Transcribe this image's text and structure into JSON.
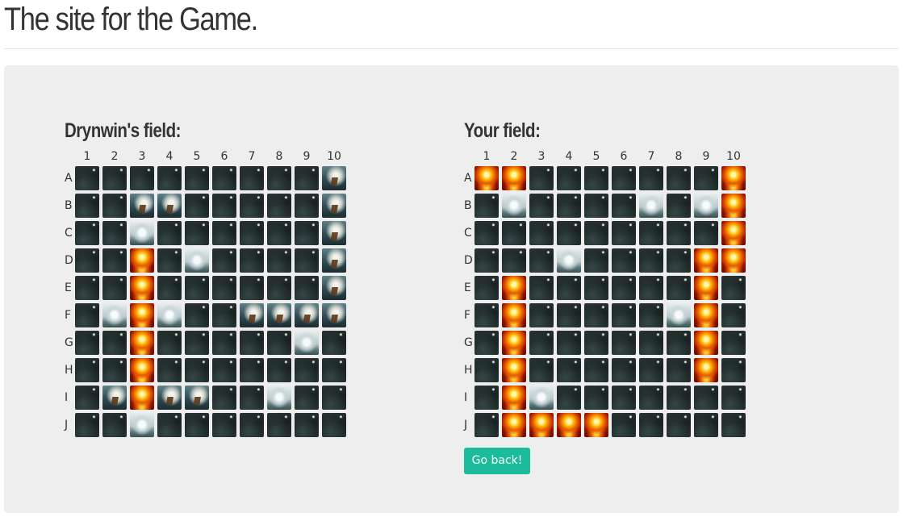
{
  "page": {
    "title": "The site for the Game."
  },
  "colors": {
    "accent": "#1abc9c",
    "panel": "#eeeeee"
  },
  "columns": [
    "1",
    "2",
    "3",
    "4",
    "5",
    "6",
    "7",
    "8",
    "9",
    "10"
  ],
  "rows": [
    "A",
    "B",
    "C",
    "D",
    "E",
    "F",
    "G",
    "H",
    "I",
    "J"
  ],
  "cell_legend": {
    "W": "water-tile",
    "M": "miss-splash-tile",
    "H": "hit-explosion-tile",
    "S": "ship-tile"
  },
  "opponent": {
    "title": "Drynwin's field:",
    "grid": [
      "WWWWWWWWWS",
      "WWSSWWWWWS",
      "WWMWWWWWWS",
      "WWHWMWWWWS",
      "WWHWWWWWWS",
      "WMHMWWSSSS",
      "WWHWWWWWMW",
      "WWHWWWWWWW",
      "WSHSSWWMWW",
      "WWMWWWWWWW"
    ]
  },
  "player": {
    "title": "Your field:",
    "grid": [
      "HHWWWWWWWH",
      "WMWWWWMWMH",
      "WWWWWWWWWH",
      "WWWMWWWWHH",
      "WHWWWWWWHW",
      "WHWWWWWMHW",
      "WHWWWWWWHW",
      "WHWWWWWWHW",
      "WHMWWWWWWW",
      "WHHHHWWWWW"
    ]
  },
  "actions": {
    "back_label": "Go back!"
  }
}
